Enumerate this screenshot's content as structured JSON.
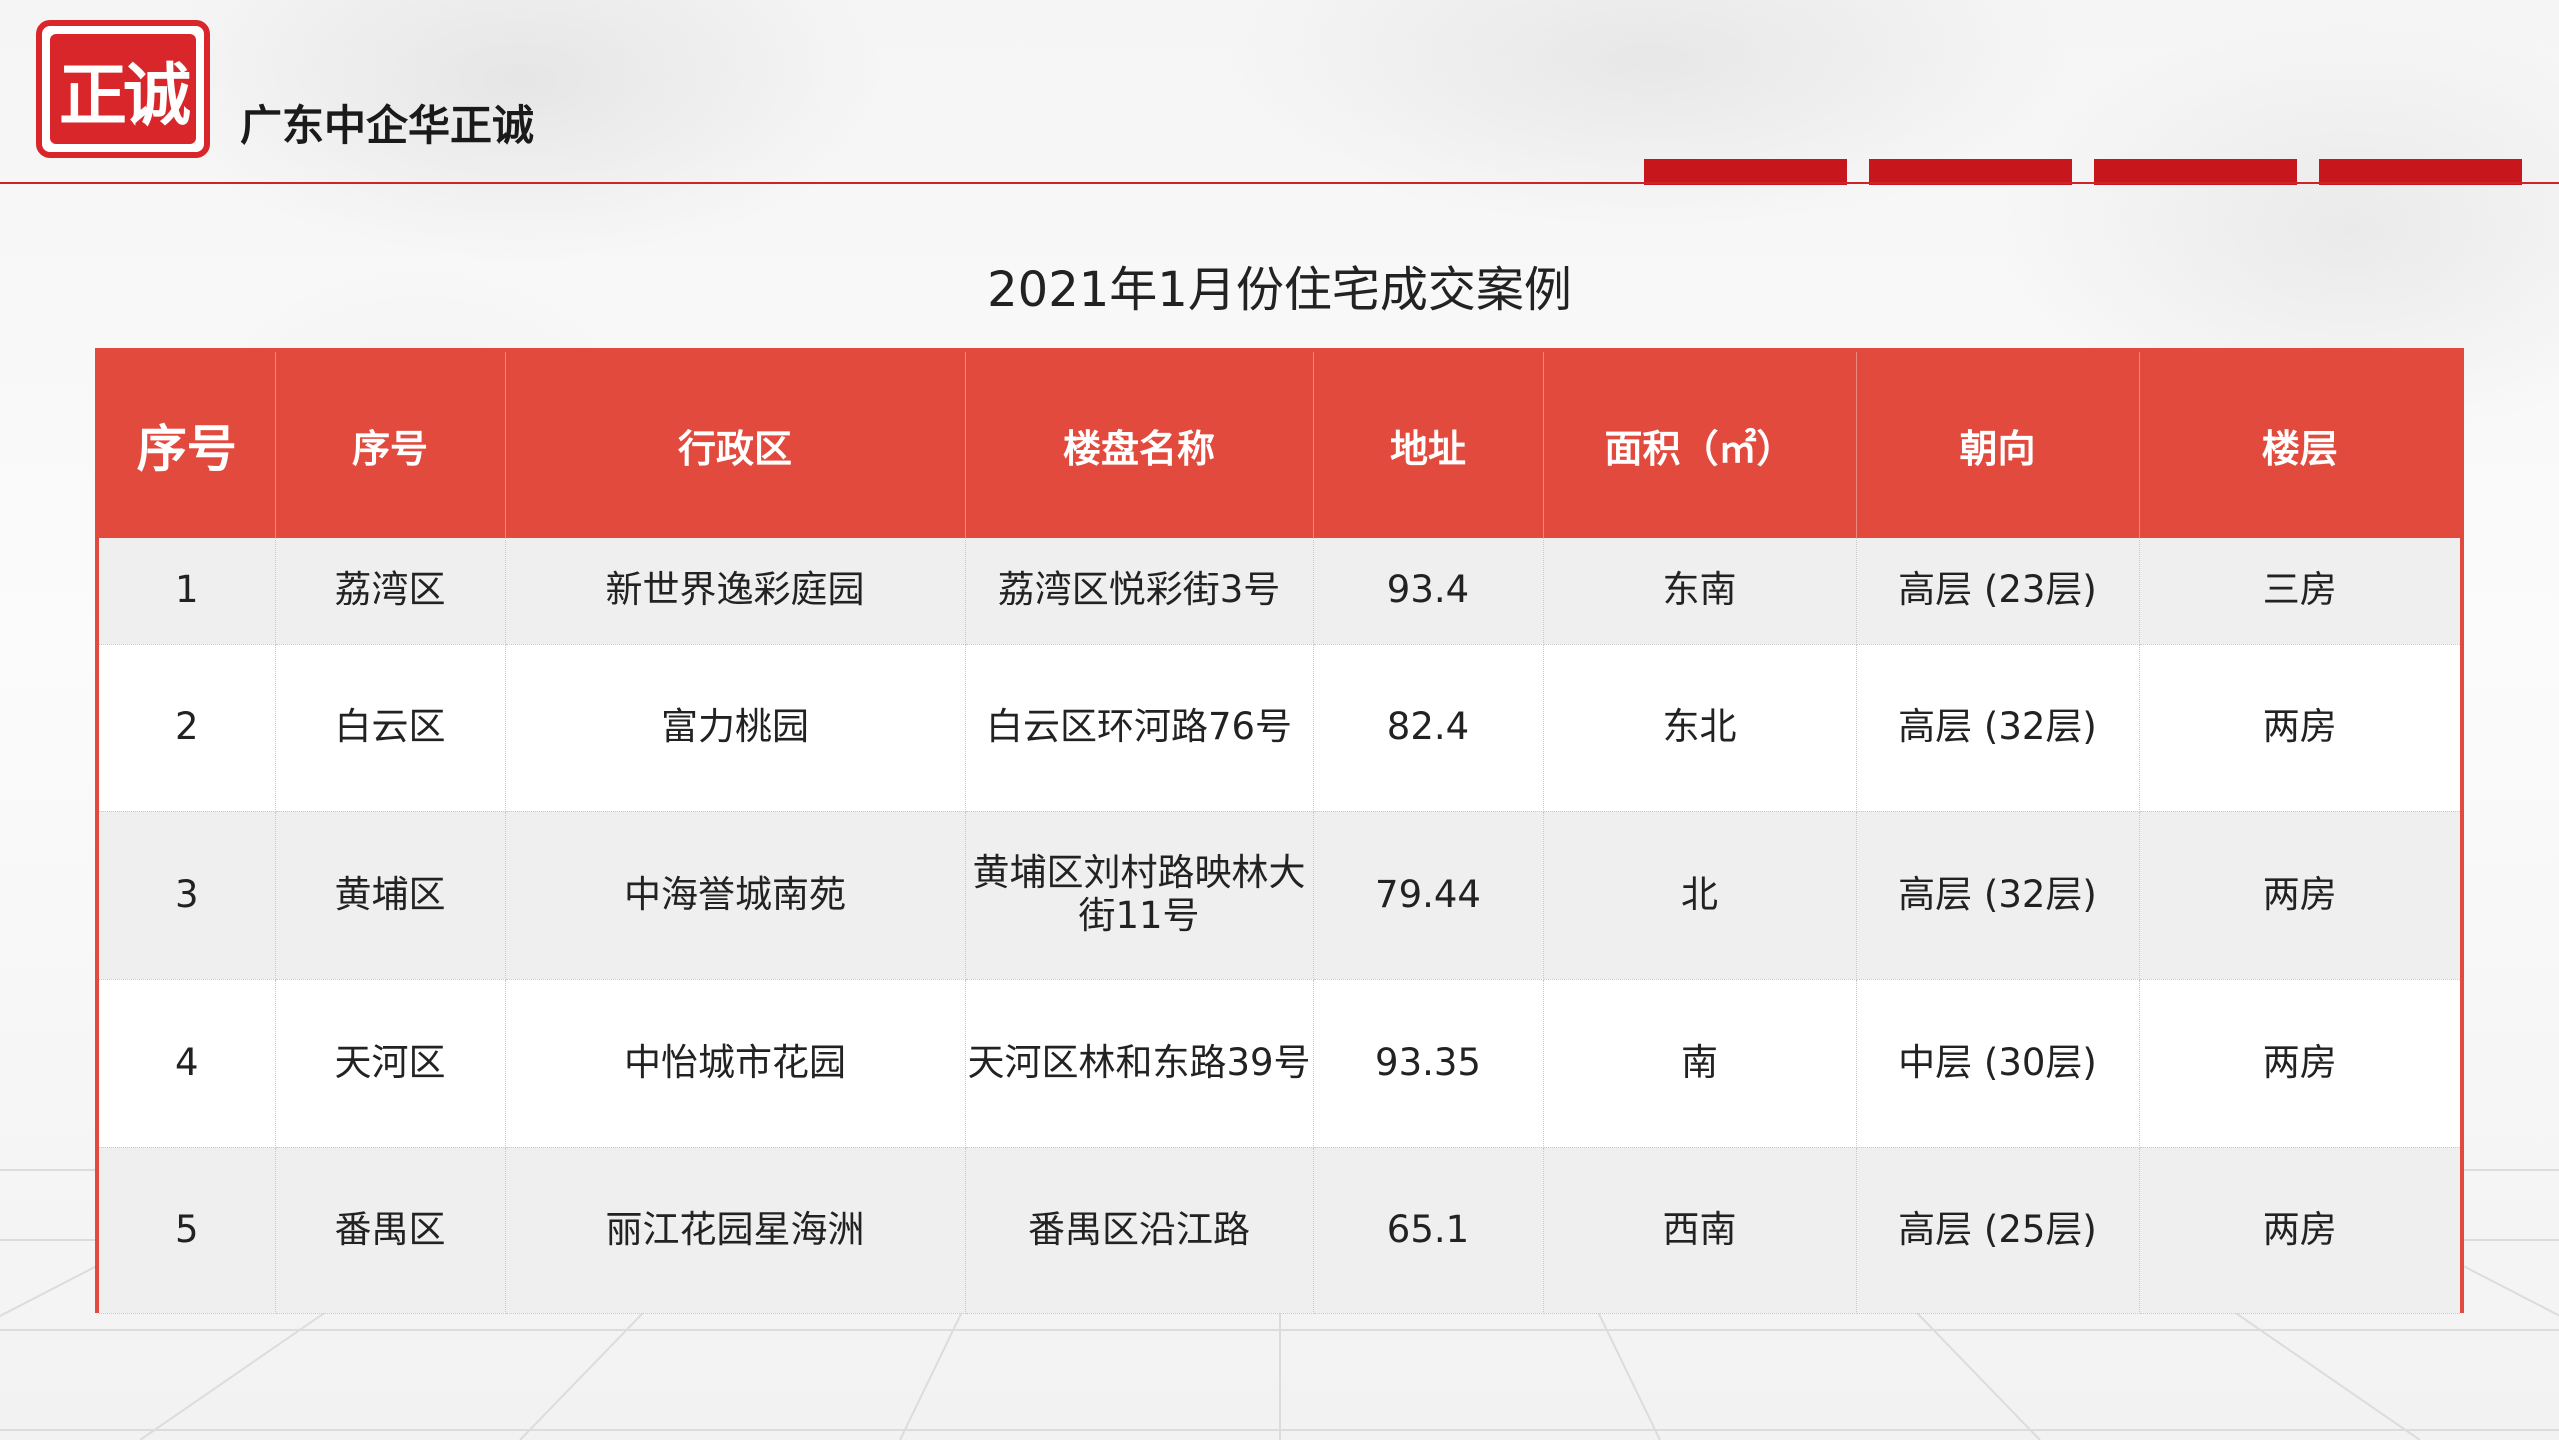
{
  "header": {
    "logo_text": "正诚",
    "company_name": "广东中企华正诚"
  },
  "title": "2021年1月份住宅成交案例",
  "table": {
    "columns": [
      "序号",
      "序号",
      "行政区",
      "楼盘名称",
      "地址",
      "面积（㎡）",
      "朝向",
      "楼层"
    ],
    "rows": [
      [
        "1",
        "荔湾区",
        "新世界逸彩庭园",
        "荔湾区悦彩街3号",
        "93.4",
        "东南",
        "高层 (23层)",
        "三房"
      ],
      [
        "2",
        "白云区",
        "富力桃园",
        "白云区环河路76号",
        "82.4",
        "东北",
        "高层 (32层)",
        "两房"
      ],
      [
        "3",
        "黄埔区",
        "中海誉城南苑",
        "黄埔区刘村路映林大街11号",
        "79.44",
        "北",
        "高层 (32层)",
        "两房"
      ],
      [
        "4",
        "天河区",
        "中怡城市花园",
        "天河区林和东路39号",
        "93.35",
        "南",
        "中层 (30层)",
        "两房"
      ],
      [
        "5",
        "番禺区",
        "丽江花园星海洲",
        "番禺区沿江路",
        "65.1",
        "西南",
        "高层 (25层)",
        "两房"
      ]
    ]
  },
  "colors": {
    "accent_red": "#e24a3e",
    "brand_red": "#c8161d"
  }
}
